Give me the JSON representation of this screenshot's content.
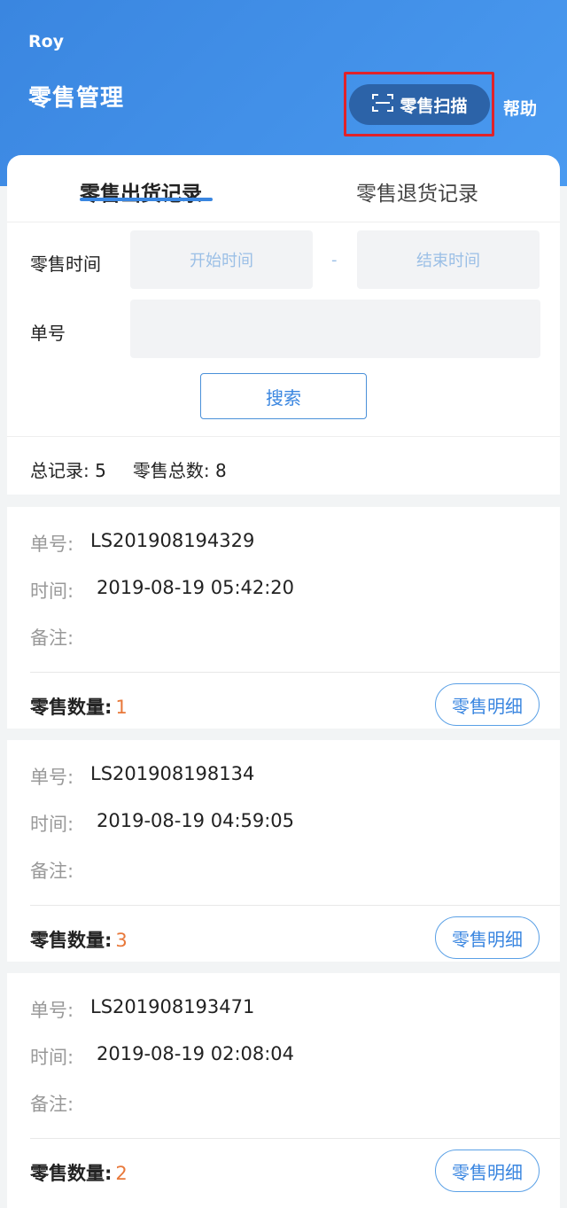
{
  "header": {
    "user": "Roy",
    "title": "零售管理",
    "scan_label": "零售扫描",
    "help_label": "帮助"
  },
  "tabs": [
    {
      "label": "零售出货记录",
      "active": true
    },
    {
      "label": "零售退货记录",
      "active": false
    }
  ],
  "filter": {
    "date_label": "零售时间",
    "start_placeholder": "开始时间",
    "separator": "-",
    "end_placeholder": "结束时间",
    "order_label": "单号",
    "order_value": "",
    "search_label": "搜索"
  },
  "summary": {
    "total_label": "总记录:",
    "total_value": "5",
    "sales_label": "零售总数:",
    "sales_value": "8"
  },
  "record_labels": {
    "order": "单号:",
    "time": "时间:",
    "note": "备注:",
    "qty": "零售数量:",
    "detail": "零售明细"
  },
  "records": [
    {
      "order": "LS201908194329",
      "time": "2019-08-19 05:42:20",
      "note": "",
      "qty": "1"
    },
    {
      "order": "LS201908198134",
      "time": "2019-08-19 04:59:05",
      "note": "",
      "qty": "3"
    },
    {
      "order": "LS201908193471",
      "time": "2019-08-19 02:08:04",
      "note": "",
      "qty": "2"
    }
  ],
  "colors": {
    "primary": "#3a86e0",
    "scan_button": "#2c63a8",
    "highlight_border": "#e0222a",
    "qty_value": "#e8783a"
  }
}
